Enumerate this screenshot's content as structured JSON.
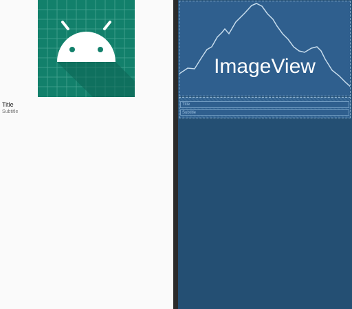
{
  "design": {
    "title": "Title",
    "subtitle": "Subtitle",
    "icon_bg_color": "#12806b"
  },
  "blueprint": {
    "image_label": "ImageView",
    "title": "Title",
    "subtitle": "Subtitle",
    "bg_color": "#244f73"
  }
}
